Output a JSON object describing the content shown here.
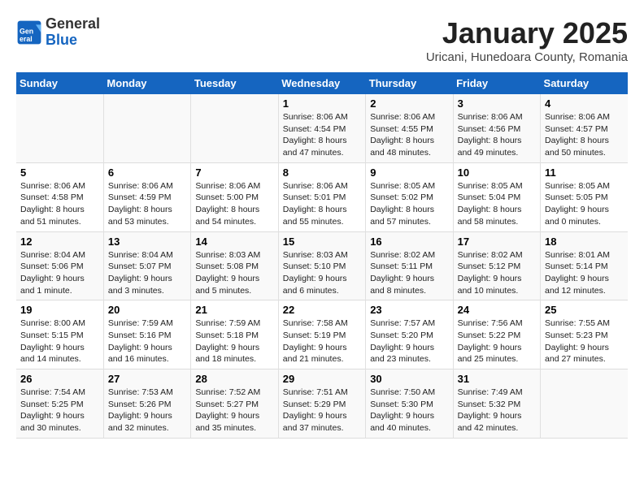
{
  "header": {
    "logo_general": "General",
    "logo_blue": "Blue",
    "title": "January 2025",
    "subtitle": "Uricani, Hunedoara County, Romania"
  },
  "columns": [
    "Sunday",
    "Monday",
    "Tuesday",
    "Wednesday",
    "Thursday",
    "Friday",
    "Saturday"
  ],
  "weeks": [
    {
      "days": [
        {
          "num": "",
          "info": ""
        },
        {
          "num": "",
          "info": ""
        },
        {
          "num": "",
          "info": ""
        },
        {
          "num": "1",
          "info": "Sunrise: 8:06 AM\nSunset: 4:54 PM\nDaylight: 8 hours and 47 minutes."
        },
        {
          "num": "2",
          "info": "Sunrise: 8:06 AM\nSunset: 4:55 PM\nDaylight: 8 hours and 48 minutes."
        },
        {
          "num": "3",
          "info": "Sunrise: 8:06 AM\nSunset: 4:56 PM\nDaylight: 8 hours and 49 minutes."
        },
        {
          "num": "4",
          "info": "Sunrise: 8:06 AM\nSunset: 4:57 PM\nDaylight: 8 hours and 50 minutes."
        }
      ]
    },
    {
      "days": [
        {
          "num": "5",
          "info": "Sunrise: 8:06 AM\nSunset: 4:58 PM\nDaylight: 8 hours and 51 minutes."
        },
        {
          "num": "6",
          "info": "Sunrise: 8:06 AM\nSunset: 4:59 PM\nDaylight: 8 hours and 53 minutes."
        },
        {
          "num": "7",
          "info": "Sunrise: 8:06 AM\nSunset: 5:00 PM\nDaylight: 8 hours and 54 minutes."
        },
        {
          "num": "8",
          "info": "Sunrise: 8:06 AM\nSunset: 5:01 PM\nDaylight: 8 hours and 55 minutes."
        },
        {
          "num": "9",
          "info": "Sunrise: 8:05 AM\nSunset: 5:02 PM\nDaylight: 8 hours and 57 minutes."
        },
        {
          "num": "10",
          "info": "Sunrise: 8:05 AM\nSunset: 5:04 PM\nDaylight: 8 hours and 58 minutes."
        },
        {
          "num": "11",
          "info": "Sunrise: 8:05 AM\nSunset: 5:05 PM\nDaylight: 9 hours and 0 minutes."
        }
      ]
    },
    {
      "days": [
        {
          "num": "12",
          "info": "Sunrise: 8:04 AM\nSunset: 5:06 PM\nDaylight: 9 hours and 1 minute."
        },
        {
          "num": "13",
          "info": "Sunrise: 8:04 AM\nSunset: 5:07 PM\nDaylight: 9 hours and 3 minutes."
        },
        {
          "num": "14",
          "info": "Sunrise: 8:03 AM\nSunset: 5:08 PM\nDaylight: 9 hours and 5 minutes."
        },
        {
          "num": "15",
          "info": "Sunrise: 8:03 AM\nSunset: 5:10 PM\nDaylight: 9 hours and 6 minutes."
        },
        {
          "num": "16",
          "info": "Sunrise: 8:02 AM\nSunset: 5:11 PM\nDaylight: 9 hours and 8 minutes."
        },
        {
          "num": "17",
          "info": "Sunrise: 8:02 AM\nSunset: 5:12 PM\nDaylight: 9 hours and 10 minutes."
        },
        {
          "num": "18",
          "info": "Sunrise: 8:01 AM\nSunset: 5:14 PM\nDaylight: 9 hours and 12 minutes."
        }
      ]
    },
    {
      "days": [
        {
          "num": "19",
          "info": "Sunrise: 8:00 AM\nSunset: 5:15 PM\nDaylight: 9 hours and 14 minutes."
        },
        {
          "num": "20",
          "info": "Sunrise: 7:59 AM\nSunset: 5:16 PM\nDaylight: 9 hours and 16 minutes."
        },
        {
          "num": "21",
          "info": "Sunrise: 7:59 AM\nSunset: 5:18 PM\nDaylight: 9 hours and 18 minutes."
        },
        {
          "num": "22",
          "info": "Sunrise: 7:58 AM\nSunset: 5:19 PM\nDaylight: 9 hours and 21 minutes."
        },
        {
          "num": "23",
          "info": "Sunrise: 7:57 AM\nSunset: 5:20 PM\nDaylight: 9 hours and 23 minutes."
        },
        {
          "num": "24",
          "info": "Sunrise: 7:56 AM\nSunset: 5:22 PM\nDaylight: 9 hours and 25 minutes."
        },
        {
          "num": "25",
          "info": "Sunrise: 7:55 AM\nSunset: 5:23 PM\nDaylight: 9 hours and 27 minutes."
        }
      ]
    },
    {
      "days": [
        {
          "num": "26",
          "info": "Sunrise: 7:54 AM\nSunset: 5:25 PM\nDaylight: 9 hours and 30 minutes."
        },
        {
          "num": "27",
          "info": "Sunrise: 7:53 AM\nSunset: 5:26 PM\nDaylight: 9 hours and 32 minutes."
        },
        {
          "num": "28",
          "info": "Sunrise: 7:52 AM\nSunset: 5:27 PM\nDaylight: 9 hours and 35 minutes."
        },
        {
          "num": "29",
          "info": "Sunrise: 7:51 AM\nSunset: 5:29 PM\nDaylight: 9 hours and 37 minutes."
        },
        {
          "num": "30",
          "info": "Sunrise: 7:50 AM\nSunset: 5:30 PM\nDaylight: 9 hours and 40 minutes."
        },
        {
          "num": "31",
          "info": "Sunrise: 7:49 AM\nSunset: 5:32 PM\nDaylight: 9 hours and 42 minutes."
        },
        {
          "num": "",
          "info": ""
        }
      ]
    }
  ]
}
